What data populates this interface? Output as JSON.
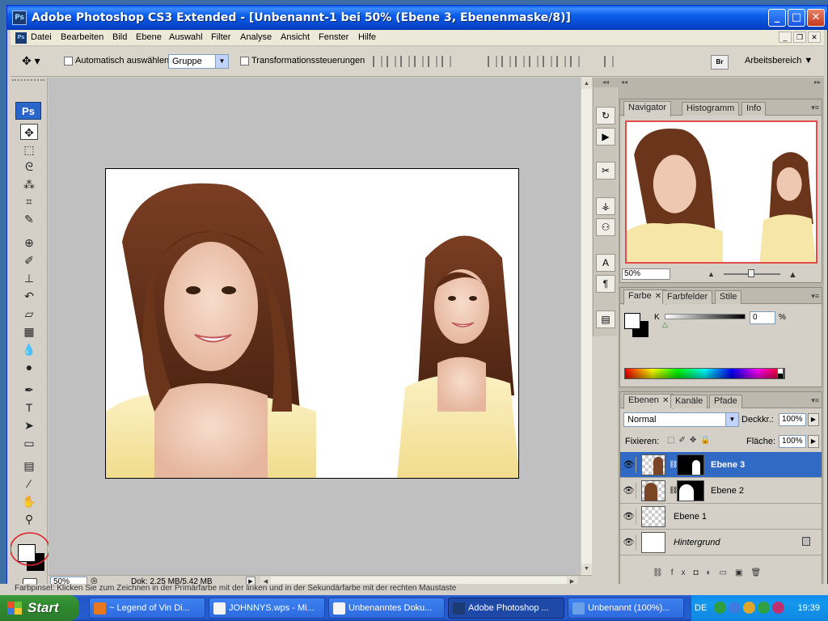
{
  "window": {
    "title": "Adobe Photoshop CS3 Extended - [Unbenannt-1 bei 50% (Ebene 3, Ebenenmaske/8)]",
    "app_icon": "Ps",
    "controls": [
      "minimize",
      "maximize",
      "close"
    ]
  },
  "menu": {
    "items": [
      "Datei",
      "Bearbeiten",
      "Bild",
      "Ebene",
      "Auswahl",
      "Filter",
      "Analyse",
      "Ansicht",
      "Fenster",
      "Hilfe"
    ]
  },
  "options": {
    "auto_select_label": "Automatisch auswählen:",
    "auto_select_value": "Gruppe",
    "transform_label": "Transformationssteuerungen",
    "bridge_label": "Br",
    "workspace_label": "Arbeitsbereich ▼"
  },
  "toolbox": {
    "logo": "Ps",
    "tools": [
      "move-tool",
      "marquee-tool",
      "lasso-tool",
      "magic-wand-tool",
      "crop-tool",
      "slice-tool",
      "healing-brush-tool",
      "brush-tool",
      "clone-stamp-tool",
      "history-brush-tool",
      "eraser-tool",
      "gradient-tool",
      "blur-tool",
      "dodge-tool",
      "pen-tool",
      "type-tool",
      "path-selection-tool",
      "shape-tool",
      "notes-tool",
      "eyedropper-tool",
      "hand-tool",
      "zoom-tool"
    ],
    "foreground_color": "#ffffff",
    "background_color": "#000000"
  },
  "document": {
    "zoom": "50%",
    "info": "Dok: 2,25 MB/5,42 MB"
  },
  "navigator": {
    "tabs": [
      "Navigator",
      "Histogramm",
      "Info"
    ],
    "zoom": "50%"
  },
  "color_panel": {
    "tabs": [
      "Farbe",
      "Farbfelder",
      "Stile"
    ],
    "channel_label": "K",
    "value": "0",
    "unit": "%"
  },
  "layers_panel": {
    "tabs": [
      "Ebenen",
      "Kanäle",
      "Pfade"
    ],
    "blend_mode": "Normal",
    "opacity_label": "Deckkr.:",
    "opacity": "100%",
    "lock_label": "Fixieren:",
    "fill_label": "Fläche:",
    "fill": "100%",
    "layers": [
      {
        "name": "Ebene 3",
        "selected": true,
        "has_mask": true
      },
      {
        "name": "Ebene 2",
        "selected": false,
        "has_mask": true
      },
      {
        "name": "Ebene 1",
        "selected": false,
        "has_mask": false
      },
      {
        "name": "Hintergrund",
        "selected": false,
        "has_mask": false,
        "locked": true
      }
    ]
  },
  "status_hint": "Farbpinsel: Klicken Sie zum Zeichnen in der Primärfarbe mit der linken und in der Sekundärfarbe mit der rechten Maustaste",
  "taskbar": {
    "start": "Start",
    "tasks": [
      "~ Legend of Vin Di...",
      "JOHNNYS.wps - Mi...",
      "Unbenanntes Doku...",
      "Adobe Photoshop ...",
      "Unbenannt (100%)..."
    ],
    "active_task": 3,
    "language": "DE",
    "clock": "19:39"
  },
  "colors": {
    "xp_blue": "#0a5ce6",
    "selection_blue": "#316ac5",
    "navigator_frame": "#e34b4b",
    "annotation_red": "#e0202a"
  }
}
